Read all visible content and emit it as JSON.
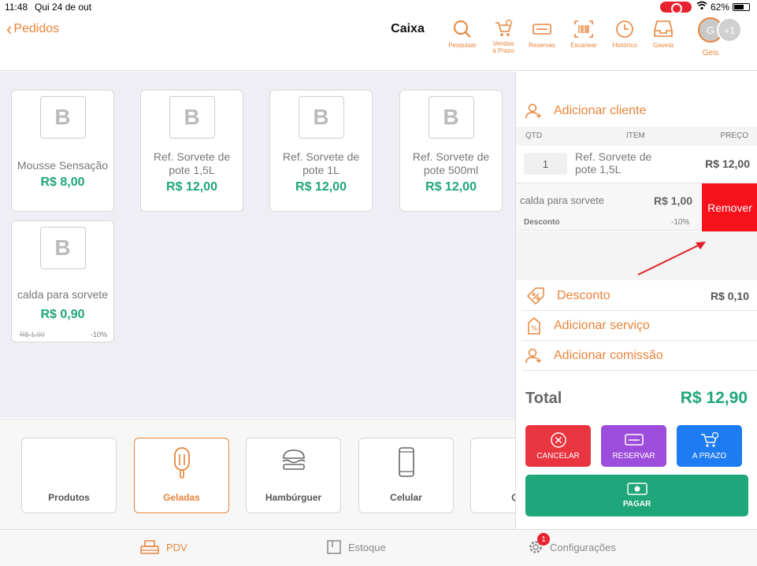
{
  "status_bar": {
    "time": "11:48",
    "date": "Qui 24 de out",
    "battery": "62%"
  },
  "nav": {
    "back_label": "Pedidos",
    "title": "Caixa",
    "tools": [
      "Pesquisar",
      "Vendas\nà Prazo",
      "Reservas",
      "Escanear",
      "Histórico",
      "Gaveta"
    ],
    "avatars": {
      "initial": "G",
      "more": "+1",
      "name": "Geis"
    }
  },
  "products": [
    {
      "thumb": "B",
      "name": "Mousse Sensação",
      "price": "R$ 8,00"
    },
    {
      "thumb": "B",
      "name": "Ref. Sorvete de pote 1,5L",
      "price": "R$ 12,00"
    },
    {
      "thumb": "B",
      "name": "Ref. Sorvete de pote 1L",
      "price": "R$ 12,00"
    },
    {
      "thumb": "B",
      "name": "Ref. Sorvete de pote 500ml",
      "price": "R$ 12,00"
    },
    {
      "thumb": "B",
      "name": "calda para sorvete",
      "price": "R$ 0,90",
      "old_price": "R$ 1,00",
      "discount": "-10%"
    }
  ],
  "categories": [
    "Produtos",
    "Geladas",
    "Hambúrguer",
    "Celular",
    "Qu"
  ],
  "cart": {
    "add_client": "Adicionar cliente",
    "columns": {
      "qty": "QTD",
      "item": "ITEM",
      "price": "PREÇO"
    },
    "item": {
      "qty": "1",
      "name": "Ref. Sorvete de pote 1,5L",
      "price": "R$ 12,00"
    },
    "sub_item": {
      "name": "calda para sorvete",
      "price": "R$ 1,00",
      "discount_label": "Desconto",
      "discount_value": "-10%",
      "remove_label": "Remover"
    },
    "discount": {
      "label": "Desconto",
      "value": "R$ 0,10"
    },
    "add_service": "Adicionar serviço",
    "add_commission": "Adicionar comissão",
    "total_label": "Total",
    "total_value": "R$ 12,90",
    "actions": {
      "cancel": "CANCELAR",
      "reserve": "RESERVAR",
      "term": "A PRAZO",
      "pay": "PAGAR"
    }
  },
  "tabbar": {
    "pdv": "PDV",
    "stock": "Estoque",
    "settings": "Configurações",
    "settings_badge": "1"
  },
  "colors": {
    "accent": "#e8843a",
    "green": "#1fa67a",
    "red": "#e8353f",
    "purple": "#9d4ddb",
    "blue": "#1d7cf2",
    "remove": "#f5121b"
  }
}
